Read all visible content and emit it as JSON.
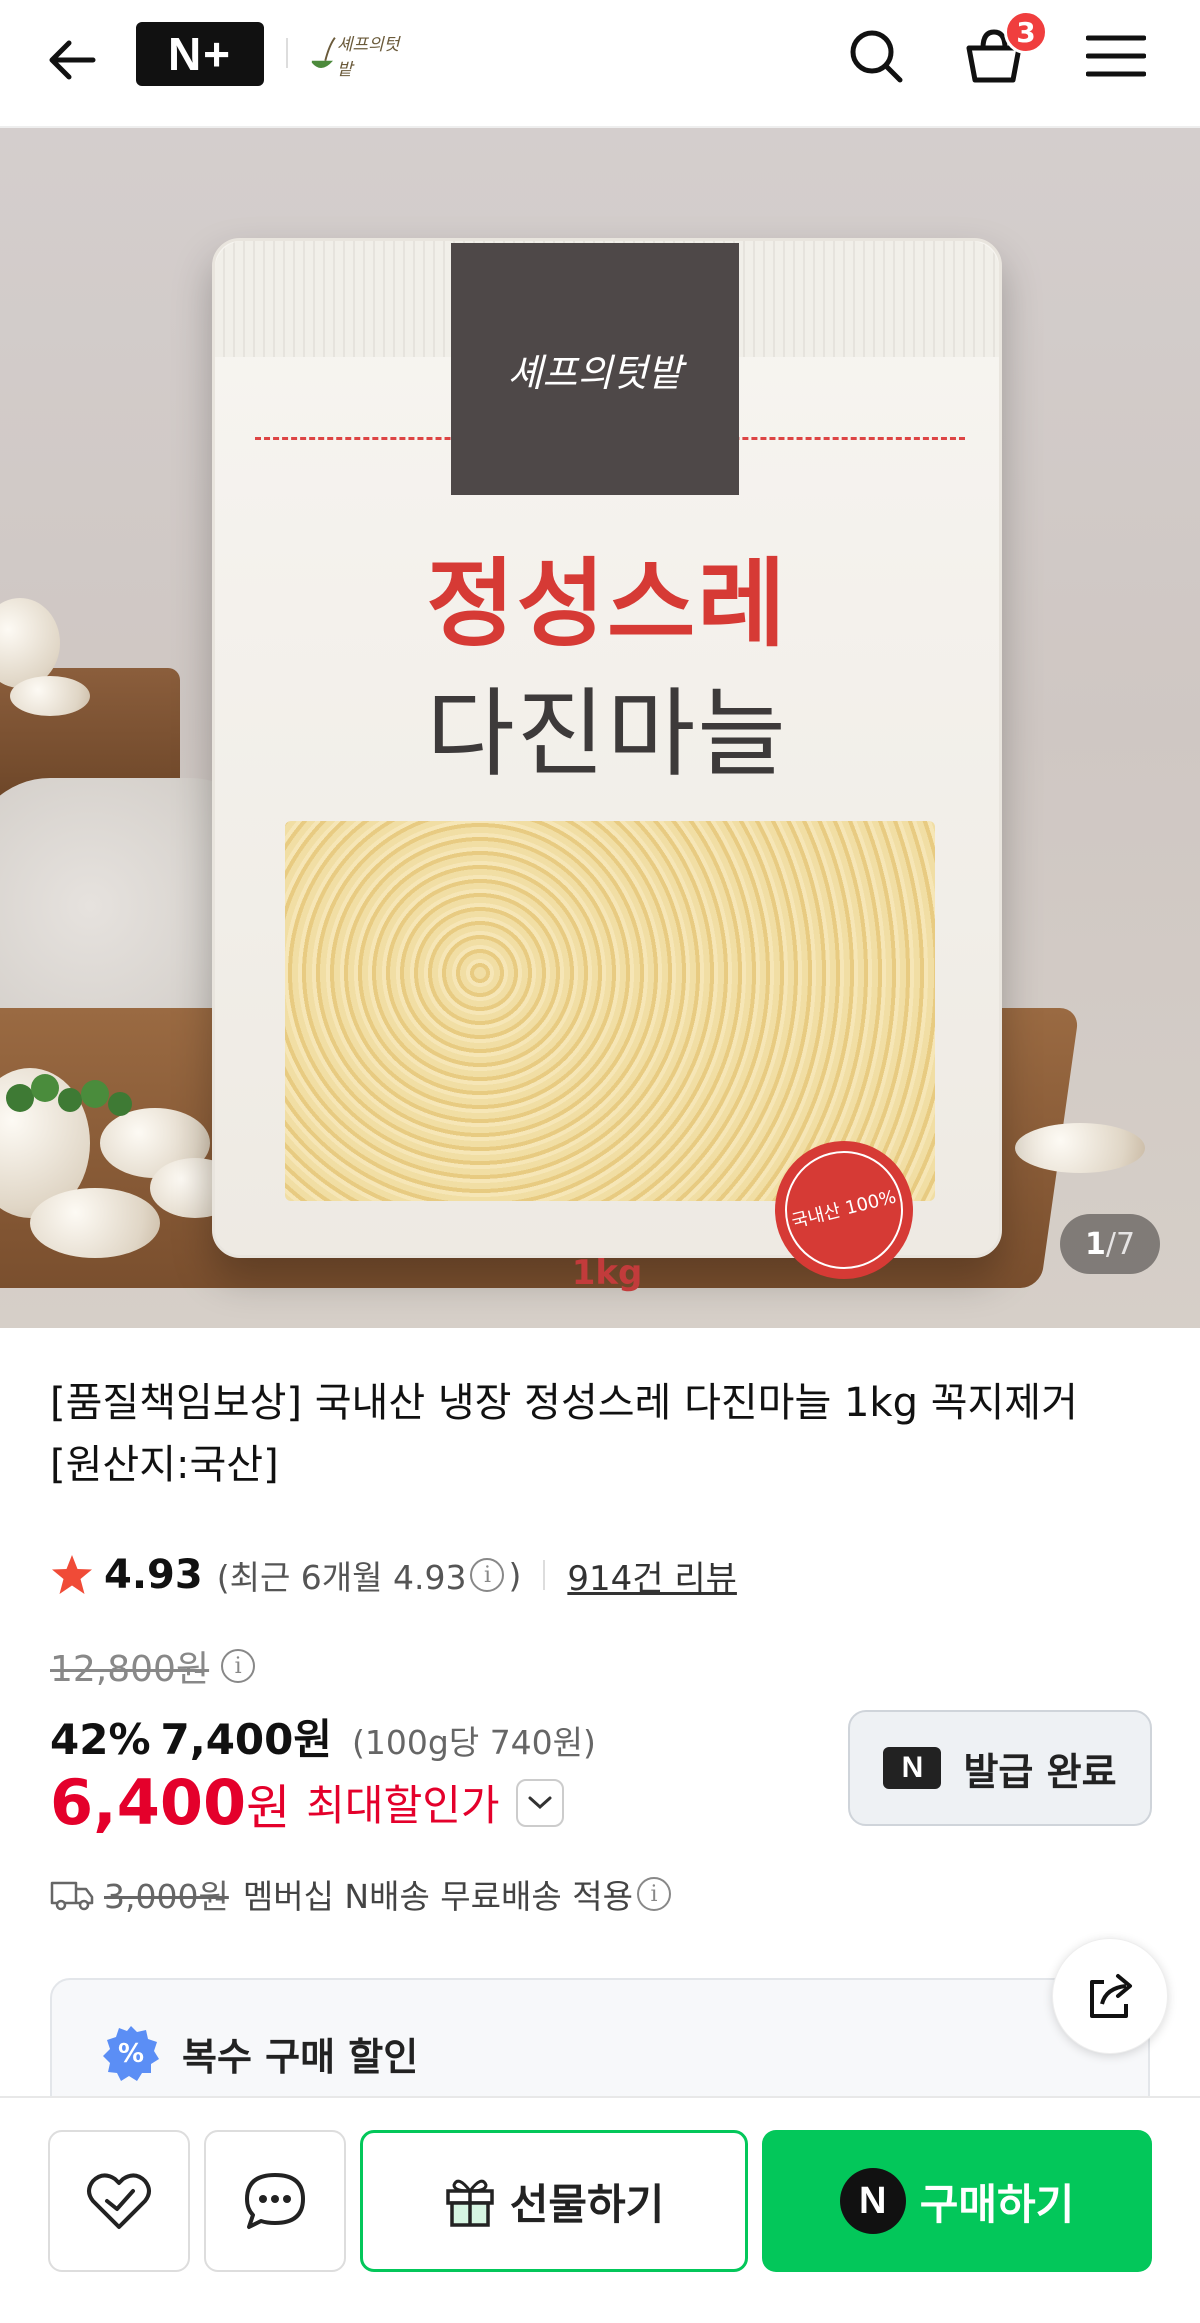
{
  "header": {
    "logo_text": "N+",
    "brand_logo_text": "셰프의텃밭",
    "cart_count": "3"
  },
  "gallery": {
    "current": "1",
    "separator": "/",
    "total": "7",
    "bag_brand": "셰프의텃밭",
    "bag_title_line1": "정성스레",
    "bag_title_line2": "다진마늘",
    "bag_weight": "1kg",
    "bag_stamp": "국내산 100%"
  },
  "product": {
    "title": "[품질책임보상] 국내산 냉장 정성스레 다진마늘 1kg 꼭지제거 [원산지:국산]",
    "rating": "4.93",
    "rating_recent_prefix": "(최근 6개월 4.93",
    "rating_recent_suffix": ")",
    "review_count": "914건 리뷰",
    "original_price": "12,800원",
    "discount_rate": "42%",
    "sale_price": "7,400원",
    "unit_price": "(100g당 740원)",
    "max_price": "6,400",
    "max_price_unit": "원",
    "max_price_label": "최대할인가",
    "coupon_button": "발급 완료",
    "coupon_badge": "N",
    "shipping_fee": "3,000원",
    "shipping_text": "멤버십 N배송 무료배송 적용"
  },
  "multi_discount": {
    "title": "복수 구매 할인"
  },
  "bottom_bar": {
    "gift_label": "선물하기",
    "buy_label": "구매하기",
    "buy_badge": "N"
  },
  "colors": {
    "accent_green": "#03c75a",
    "price_red": "#e4002b",
    "badge_red": "#f03e3e"
  }
}
